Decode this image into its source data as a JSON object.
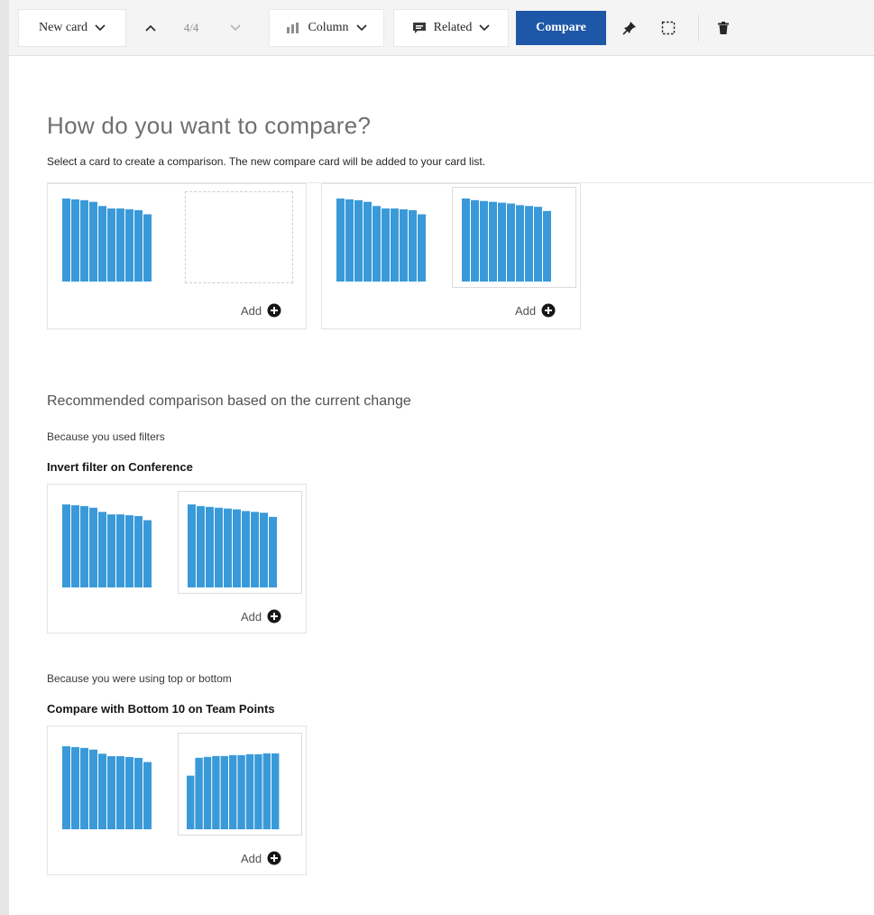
{
  "toolbar": {
    "new_card_label": "New card",
    "page_indicator": "4/4",
    "column_label": "Column",
    "related_label": "Related",
    "compare_label": "Compare"
  },
  "heading": "How do you want to compare?",
  "subtext": "Select a card to create a comparison. The new compare card will be added to your card list.",
  "options": [
    {
      "add_label": "Add"
    },
    {
      "add_label": "Add"
    }
  ],
  "recommended": {
    "title": "Recommended comparison based on the current change",
    "items": [
      {
        "reason": "Because you used filters",
        "title": "Invert filter on Conference",
        "add_label": "Add"
      },
      {
        "reason": "Because you were using top or bottom",
        "title": "Compare with Bottom 10 on Team Points",
        "add_label": "Add"
      }
    ]
  },
  "colors": {
    "bar": "#3a9ad9",
    "accent": "#1f57a8"
  },
  "mini_charts": {
    "descending": [
      100,
      99,
      98,
      96,
      91,
      88,
      88,
      87,
      86,
      81
    ],
    "descending_b": [
      100,
      98,
      97,
      96,
      95,
      94,
      92,
      91,
      90,
      85
    ],
    "ascending": [
      60,
      80,
      81,
      82,
      82,
      83,
      83,
      84,
      84,
      85,
      85
    ]
  }
}
